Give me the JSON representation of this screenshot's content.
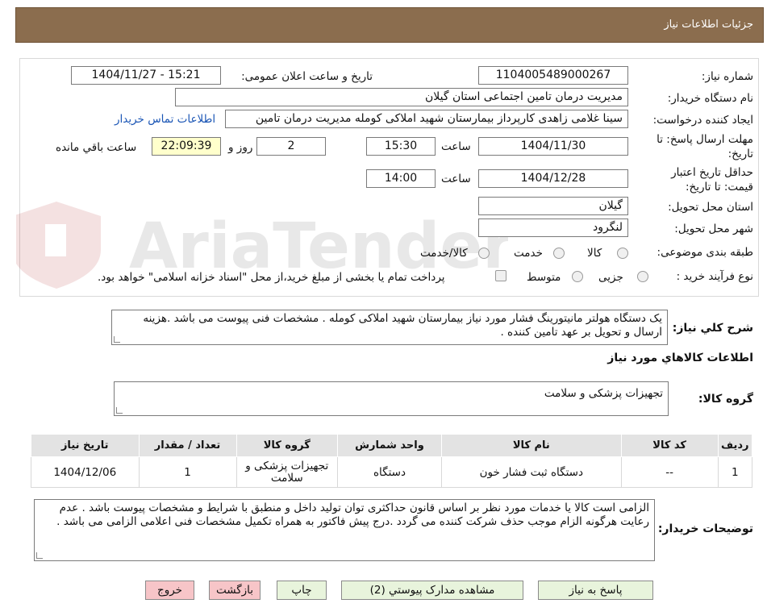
{
  "header": {
    "title": "جزئیات اطلاعات نیاز"
  },
  "fields": {
    "need_number_label": "شماره نیاز:",
    "need_number": "1104005489000267",
    "announce_label": "تاریخ و ساعت اعلان عمومی:",
    "announce_value": "1404/11/27 - 15:21",
    "buyer_label": "نام دستگاه خریدار:",
    "buyer_value": "مدیریت درمان تامین اجتماعی استان گیلان",
    "creator_label": "ایجاد کننده درخواست:",
    "creator_value": "سینا غلامی زاهدی کارپرداز بیمارستان شهید املاکی کوملە مدیریت درمان تامین",
    "contact_link": "اطلاعات تماس خریدار",
    "deadline_label_1": "مهلت ارسال پاسخ: تا",
    "deadline_label_2": "تاریخ:",
    "deadline_date": "1404/11/30",
    "time_label": "ساعت",
    "deadline_time": "15:30",
    "days_value": "2",
    "days_label": "روز و",
    "remaining_time": "22:09:39",
    "remaining_label": "ساعت باقي مانده",
    "validity_label_1": "حداقل تاریخ اعتبار",
    "validity_label_2": "قیمت: تا تاریخ:",
    "validity_date": "1404/12/28",
    "validity_time_label": "ساعت",
    "validity_time": "14:00",
    "province_label": "استان محل تحویل:",
    "province_value": "گیلان",
    "city_label": "شهر محل تحویل:",
    "city_value": "لنگرود",
    "category_label": "طبقه بندی موضوعی:",
    "category_options": [
      "کالا",
      "خدمت",
      "کالا/خدمت"
    ],
    "process_label": "نوع فرآیند خرید :",
    "process_options": [
      "جزیی",
      "متوسط"
    ],
    "payment_note": "پرداخت تمام یا بخشی از مبلغ خرید،از محل \"اسناد خزانه اسلامی\" خواهد بود."
  },
  "description": {
    "label": "شرح کلي نياز:",
    "text": "یک دستگاه هولتر مانیتورینگ فشار مورد نیاز بیمارستان شهید املاکی کوملە . مشخصات فنی پیوست می باشد .هزینه ارسال و تحویل بر عهد تامین کننده ."
  },
  "goods_section": {
    "title": "اطلاعات کالاهاي مورد نياز",
    "group_label": "گروه کالا:",
    "group_value": "تجهیزات پزشکی و سلامت"
  },
  "table": {
    "headers": [
      "رديف",
      "کد کالا",
      "نام کالا",
      "واحد شمارش",
      "گروه کالا",
      "تعداد / مقدار",
      "تاریخ نیاز"
    ],
    "rows": [
      [
        "1",
        "--",
        "دستگاه ثبت فشار خون",
        "دستگاه",
        "تجهیزات پزشکی و سلامت",
        "1",
        "1404/12/06"
      ]
    ]
  },
  "buyer_notes": {
    "label": "توضيحات خريدار:",
    "text": "الزامی است کالا یا خدمات مورد نظر بر اساس قانون حداکثری توان تولید داخل و منطبق با شرایط و مشخصات پیوست باشد . عدم رعایت هرگونه الزام موجب حذف شرکت کننده می گردد .درج پیش فاکتور به همراه تکمیل مشخصات فنی اعلامی الزامی می باشد ."
  },
  "buttons": {
    "reply": "پاسخ به نیاز",
    "attachments": "مشاهده مدارک پیوستي (2)",
    "print": "چاپ",
    "back": "بازگشت",
    "exit": "خروج"
  },
  "watermark": {
    "text": "AriaTender.neT"
  },
  "colors": {
    "header_bg": "#8b6d4e",
    "link": "#1a55b5",
    "green_button": "#e8f4dc",
    "red_button": "#f7c5c8"
  }
}
